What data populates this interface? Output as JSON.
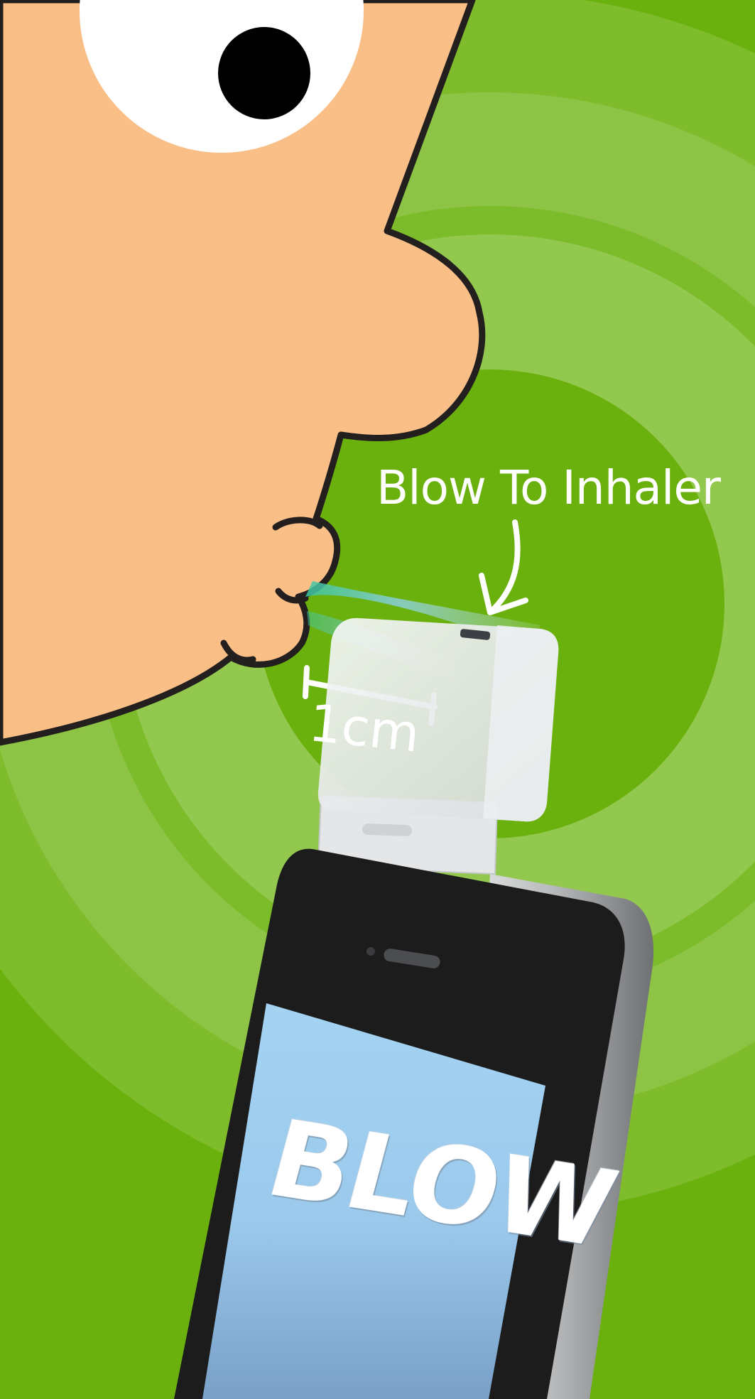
{
  "illustration": {
    "callout_label": "Blow To Inhaler",
    "distance_label": "1cm",
    "screen_text": "BLOW"
  },
  "colors": {
    "background": "#6bb10d",
    "ring_light": "#90c64a",
    "ring_mid": "#7ebc2c",
    "skin": "#f9bf87",
    "outline": "#231f1f",
    "screen_top": "#a4d3f2",
    "screen_bottom": "#7aa0c7",
    "text": "#ffffff"
  },
  "icons": [
    "face-illustration",
    "eye-icon",
    "breath-stream",
    "arrow-icon",
    "inhaler-device",
    "smartphone"
  ]
}
